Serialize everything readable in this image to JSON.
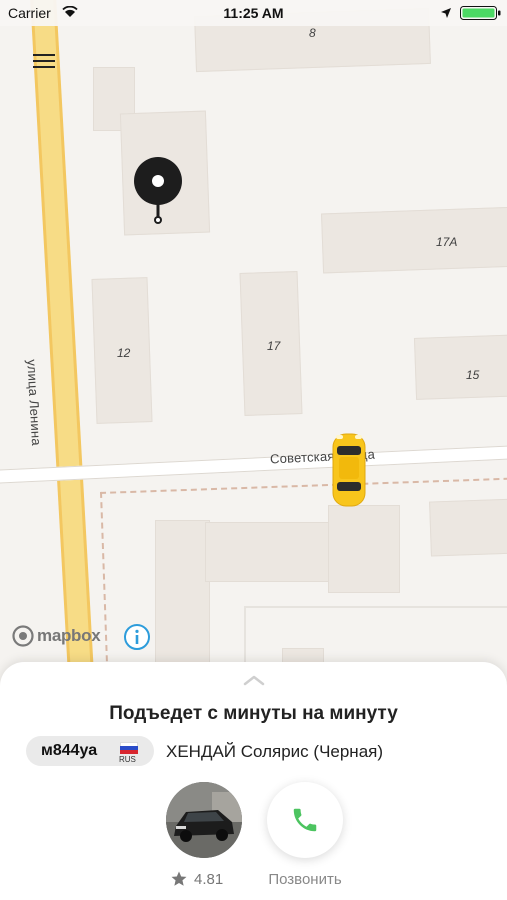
{
  "status_bar": {
    "carrier": "Carrier",
    "time": "11:25 AM"
  },
  "map": {
    "house_numbers": {
      "b8": "8",
      "b17a": "17А",
      "b12": "12",
      "b17": "17",
      "b15": "15"
    },
    "streets": {
      "lenina": "улица Ленина",
      "sovetskaya": "Советская улица"
    },
    "attribution": "mapbox"
  },
  "sheet": {
    "title": "Подъедет с минуты на минуту",
    "plate": {
      "number": "м844уа",
      "region": "RUS"
    },
    "car_description": "ХЕНДАЙ Солярис (Черная)",
    "driver_rating": "4.81",
    "call_label": "Позвонить"
  },
  "colors": {
    "road_major": "#f7dc86",
    "taxi": "#f8c51c",
    "call_green": "#4cc460"
  },
  "icons": [
    "wifi-icon",
    "location-arrow-icon",
    "battery-icon",
    "menu-icon",
    "map-pin-icon",
    "taxi-car-icon",
    "info-icon",
    "grabber-chevron-icon",
    "flag-icon",
    "star-icon",
    "phone-icon"
  ]
}
